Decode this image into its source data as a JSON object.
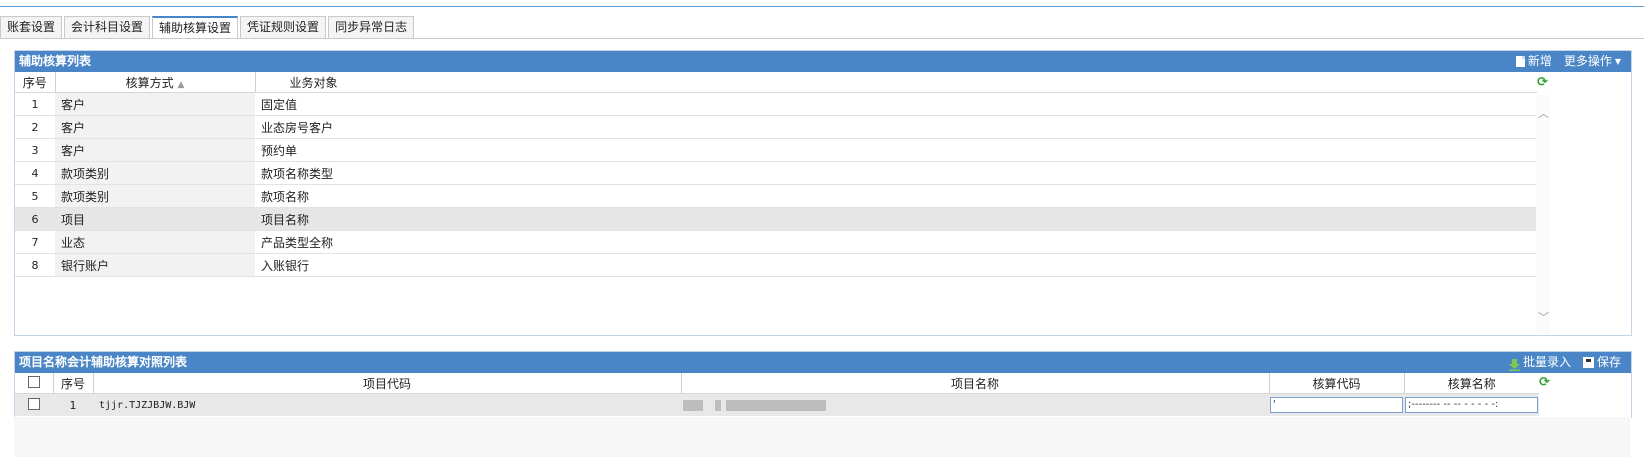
{
  "tabs": [
    "账套设置",
    "会计科目设置",
    "辅助核算设置",
    "凭证规则设置",
    "同步异常日志"
  ],
  "active_tab_index": 2,
  "panel1": {
    "title": "辅助核算列表",
    "add_label": "新增",
    "more_label": "更多操作",
    "columns": {
      "index": "序号",
      "method": "核算方式",
      "object": "业务对象"
    },
    "sort_indicator": "▲",
    "rows": [
      {
        "no": "1",
        "method": "客户",
        "object": "固定值"
      },
      {
        "no": "2",
        "method": "客户",
        "object": "业态房号客户"
      },
      {
        "no": "3",
        "method": "客户",
        "object": "预约单"
      },
      {
        "no": "4",
        "method": "款项类别",
        "object": "款项名称类型"
      },
      {
        "no": "5",
        "method": "款项类别",
        "object": "款项名称"
      },
      {
        "no": "6",
        "method": "项目",
        "object": "项目名称"
      },
      {
        "no": "7",
        "method": "业态",
        "object": "产品类型全称"
      },
      {
        "no": "8",
        "method": "银行账户",
        "object": "入账银行"
      }
    ],
    "selected_row": 6
  },
  "panel2": {
    "title": "项目名称会计辅助核算对照列表",
    "batch_label": "批量录入",
    "save_label": "保存",
    "columns": {
      "index": "序号",
      "code": "项目代码",
      "name": "项目名称",
      "acct_code": "核算代码",
      "acct_name": "核算名称"
    },
    "rows": [
      {
        "no": "1",
        "code": "tjjr.TJZJBJW.BJW",
        "acct_code": "'",
        "acct_name": ";-------- -- -- - - - - -:"
      }
    ]
  },
  "colors": {
    "header_blue": "#4a86c7",
    "refresh_green": "#2ea12e"
  }
}
